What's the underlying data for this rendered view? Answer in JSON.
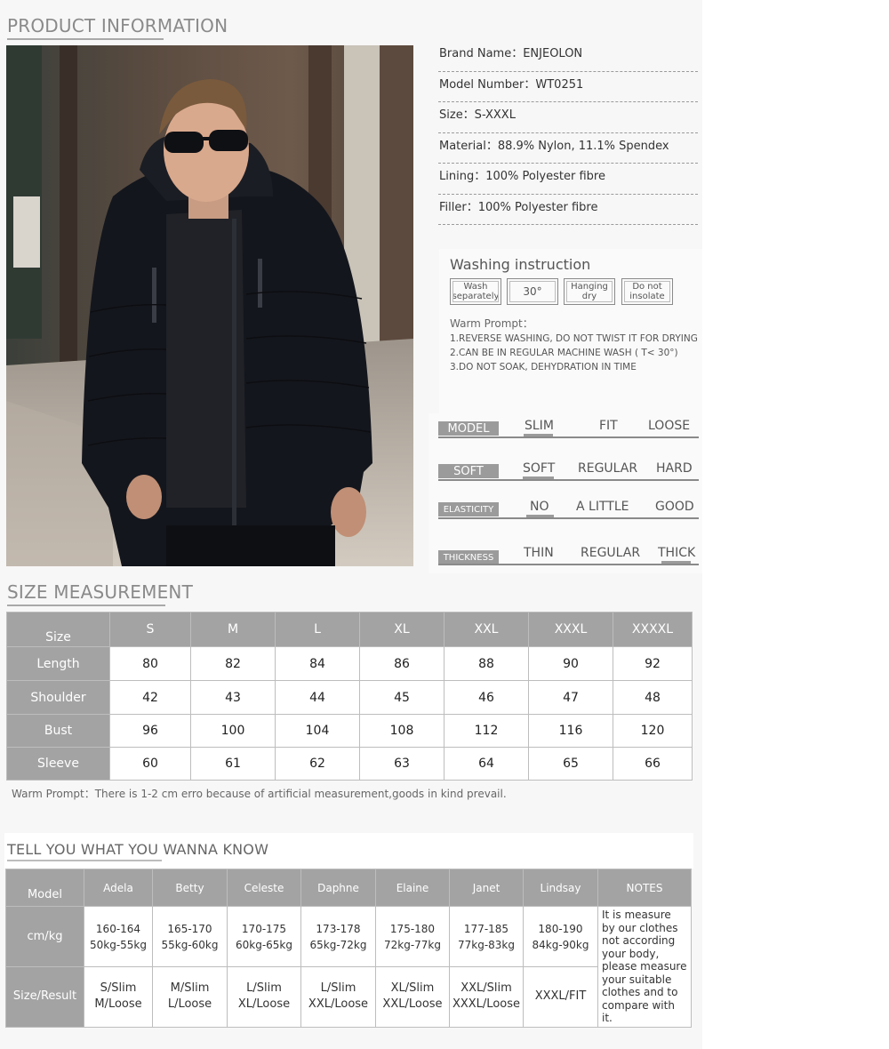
{
  "sections": {
    "product": "PRODUCT INFORMATION",
    "size": "SIZE MEASUREMENT",
    "know": "TELL YOU WHAT YOU  WANNA  KNOW"
  },
  "info": [
    "Brand Name：ENJEOLON",
    "Model Number：WT0251",
    "Size：S-XXXL",
    "Material：88.9% Nylon, 11.1% Spendex",
    "Lining：100% Polyester fibre",
    "Filler：100% Polyester fibre"
  ],
  "washing": {
    "title": "Washing instruction",
    "icons": [
      {
        "line1": "Wash",
        "line2": "separately"
      },
      {
        "line1": "30°",
        "line2": ""
      },
      {
        "line1": "Hanging",
        "line2": "dry"
      },
      {
        "line1": "Do not",
        "line2": "insolate"
      }
    ],
    "prompt": "Warm Prompt：",
    "lines": [
      "1.REVERSE WASHING, DO NOT TWIST IT FOR DRYING",
      "2.CAN BE IN REGULAR MACHINE WASH ( T< 30°)",
      "3.DO NOT SOAK, DEHYDRATION IN TIME"
    ]
  },
  "attributes": [
    {
      "label": "MODEL",
      "options": [
        "SLIM",
        "FIT",
        "LOOSE"
      ],
      "selected": 0
    },
    {
      "label": "SOFT",
      "options": [
        "SOFT",
        "REGULAR",
        "HARD"
      ],
      "selected": 0
    },
    {
      "label": "ELASTICITY",
      "options": [
        "NO",
        "A  LITTLE",
        "GOOD"
      ],
      "selected": 0
    },
    {
      "label": "THICKNESS",
      "options": [
        "THIN",
        "REGULAR",
        "THICK"
      ],
      "selected": 2
    }
  ],
  "size_table": {
    "headers": [
      "Size",
      "S",
      "M",
      "L",
      "XL",
      "XXL",
      "XXXL",
      "XXXXL"
    ],
    "rows": [
      {
        "name": "Length",
        "values": [
          "80",
          "82",
          "84",
          "86",
          "88",
          "90",
          "92"
        ]
      },
      {
        "name": "Shoulder",
        "values": [
          "42",
          "43",
          "44",
          "45",
          "46",
          "47",
          "48"
        ]
      },
      {
        "name": "Bust",
        "values": [
          "96",
          "100",
          "104",
          "108",
          "112",
          "116",
          "120"
        ]
      },
      {
        "name": "Sleeve",
        "values": [
          "60",
          "61",
          "62",
          "63",
          "64",
          "65",
          "66"
        ]
      }
    ],
    "note": "Warm Prompt：There is 1-2 cm erro because of artificial measurement,goods in kind prevail."
  },
  "model_table": {
    "headers": [
      "Model",
      "Adela",
      "Betty",
      "Celeste",
      "Daphne",
      "Elaine",
      "Janet",
      "Lindsay",
      "NOTES"
    ],
    "cm_label": "cm/kg",
    "cm": [
      [
        "160-164",
        "50kg-55kg"
      ],
      [
        "165-170",
        "55kg-60kg"
      ],
      [
        "170-175",
        "60kg-65kg"
      ],
      [
        "173-178",
        "65kg-72kg"
      ],
      [
        "175-180",
        "72kg-77kg"
      ],
      [
        "177-185",
        "77kg-83kg"
      ],
      [
        "180-190",
        "84kg-90kg"
      ]
    ],
    "result_label": "Size/Result",
    "result": [
      [
        "S/Slim",
        "M/Loose"
      ],
      [
        "M/Slim",
        "L/Loose"
      ],
      [
        "L/Slim",
        "XL/Loose"
      ],
      [
        "L/Slim",
        "XXL/Loose"
      ],
      [
        "XL/Slim",
        "XXL/Loose"
      ],
      [
        "XXL/Slim",
        "XXXL/Loose"
      ],
      [
        "XXXL/FIT",
        ""
      ]
    ],
    "notes": "It is measure by our clothes not according your body, please measure your suitable clothes and to compare with it."
  },
  "colors": {
    "header_gray": "#a3a3a3",
    "jacket": "#14161d",
    "background": "#f7f7f7"
  }
}
